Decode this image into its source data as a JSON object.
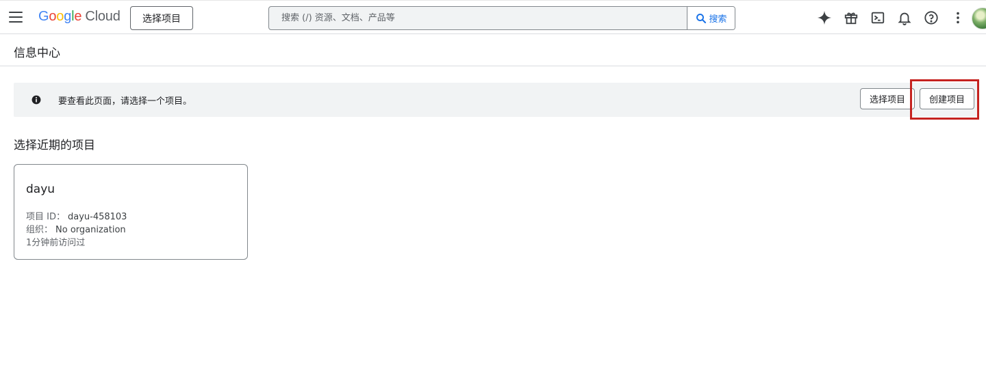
{
  "header": {
    "logo": {
      "google_letters": [
        "G",
        "o",
        "o",
        "g",
        "l",
        "e"
      ],
      "cloud": "Cloud"
    },
    "project_picker_label": "选择项目",
    "search": {
      "placeholder": "搜索 (/) 资源、文档、产品等",
      "button_label": "搜索"
    },
    "icons": [
      "gemini-sparkle-icon",
      "gift-icon",
      "cloud-shell-icon",
      "notifications-icon",
      "help-icon",
      "more-vert-icon"
    ]
  },
  "page": {
    "title": "信息中心"
  },
  "banner": {
    "icon": "info-icon",
    "message": "要查看此页面，请选择一个项目。",
    "select_button": "选择项目",
    "create_button": "创建项目"
  },
  "recent": {
    "title": "选择近期的项目",
    "projects": [
      {
        "name": "dayu",
        "id_label": "项目 ID：",
        "id_value": "dayu-458103",
        "org_label": "组织：",
        "org_value": "No organization",
        "visited": "1分钟前访问过"
      }
    ]
  },
  "colors": {
    "accent": "#1a73e8",
    "highlight": "#c5221f",
    "banner_bg": "#f1f3f4"
  }
}
